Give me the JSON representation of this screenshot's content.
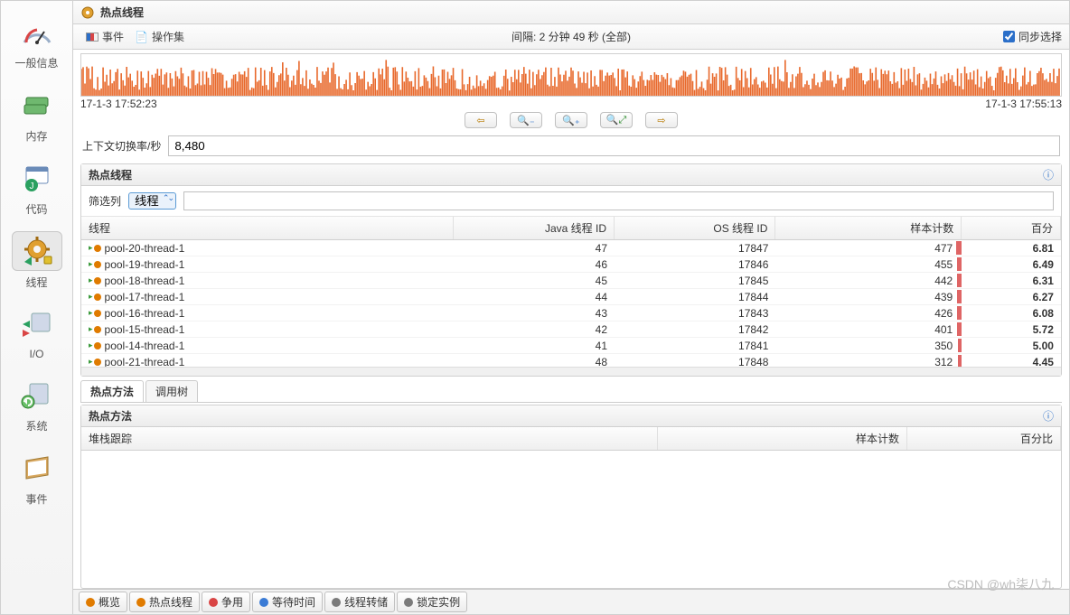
{
  "sidebar": {
    "items": [
      {
        "label": "一般信息"
      },
      {
        "label": "内存"
      },
      {
        "label": "代码"
      },
      {
        "label": "线程"
      },
      {
        "label": "I/O"
      },
      {
        "label": "系统"
      },
      {
        "label": "事件"
      }
    ]
  },
  "header": {
    "title": "热点线程"
  },
  "toolbar": {
    "events_label": "事件",
    "action_set_label": "操作集",
    "interval_text": "间隔: 2 分钟 49 秒 (全部)",
    "sync_label": "同步选择"
  },
  "timeline": {
    "start_label": "17-1-3 17:52:23",
    "end_label": "17-1-3 17:55:13"
  },
  "metric": {
    "label": "上下文切换率/秒",
    "value": "8,480"
  },
  "panel1": {
    "title": "热点线程",
    "filter_label": "筛选列",
    "filter_options": [
      "线程"
    ],
    "filter_selected": "线程",
    "columns": {
      "thread": "线程",
      "java_id": "Java 线程 ID",
      "os_id": "OS 线程 ID",
      "sample": "样本计数",
      "percent": "百分"
    },
    "rows": [
      {
        "name": "pool-20-thread-1",
        "java_id": 47,
        "os_id": 17847,
        "sample": 477,
        "percent": "6.81"
      },
      {
        "name": "pool-19-thread-1",
        "java_id": 46,
        "os_id": 17846,
        "sample": 455,
        "percent": "6.49"
      },
      {
        "name": "pool-18-thread-1",
        "java_id": 45,
        "os_id": 17845,
        "sample": 442,
        "percent": "6.31"
      },
      {
        "name": "pool-17-thread-1",
        "java_id": 44,
        "os_id": 17844,
        "sample": 439,
        "percent": "6.27"
      },
      {
        "name": "pool-16-thread-1",
        "java_id": 43,
        "os_id": 17843,
        "sample": 426,
        "percent": "6.08"
      },
      {
        "name": "pool-15-thread-1",
        "java_id": 42,
        "os_id": 17842,
        "sample": 401,
        "percent": "5.72"
      },
      {
        "name": "pool-14-thread-1",
        "java_id": 41,
        "os_id": 17841,
        "sample": 350,
        "percent": "5.00"
      },
      {
        "name": "pool-21-thread-1",
        "java_id": 48,
        "os_id": 17848,
        "sample": 312,
        "percent": "4.45"
      }
    ],
    "max_sample": 477
  },
  "subtabs": {
    "hot_methods": "热点方法",
    "call_tree": "调用树"
  },
  "panel2": {
    "title": "热点方法",
    "columns": {
      "stack": "堆栈跟踪",
      "sample": "样本计数",
      "percent": "百分比"
    }
  },
  "bottom_tabs": {
    "items": [
      {
        "label": "概览",
        "color": "#e07b00"
      },
      {
        "label": "热点线程",
        "color": "#e07b00"
      },
      {
        "label": "争用",
        "color": "#d94545"
      },
      {
        "label": "等待时间",
        "color": "#3a7bd5"
      },
      {
        "label": "线程转储",
        "color": "#7a7a7a"
      },
      {
        "label": "锁定实例",
        "color": "#7a7a7a"
      }
    ]
  },
  "watermark": "CSDN @wh柒八九"
}
